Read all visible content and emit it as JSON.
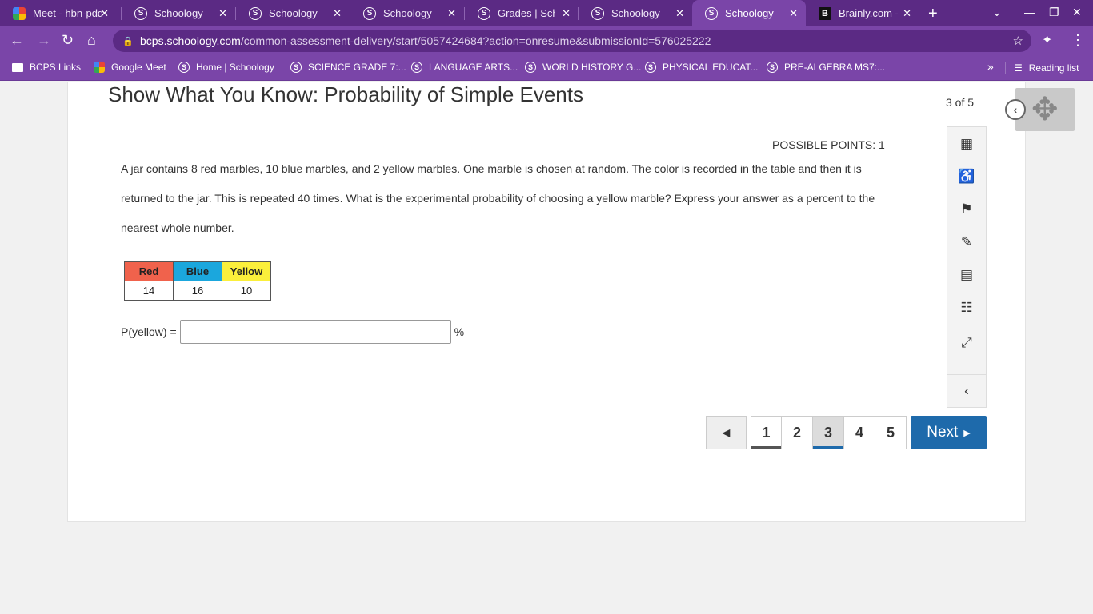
{
  "browser": {
    "tabs": [
      {
        "title": "Meet - hbn-pdq",
        "favicon": "google-meet-icon",
        "active": false
      },
      {
        "title": "Schoology",
        "favicon": "schoology-icon",
        "active": false
      },
      {
        "title": "Schoology",
        "favicon": "schoology-icon",
        "active": false
      },
      {
        "title": "Schoology",
        "favicon": "schoology-icon",
        "active": false
      },
      {
        "title": "Grades | Schoology",
        "favicon": "schoology-icon",
        "active": false
      },
      {
        "title": "Schoology",
        "favicon": "schoology-icon",
        "active": false
      },
      {
        "title": "Schoology",
        "favicon": "schoology-icon",
        "active": true
      },
      {
        "title": "Brainly.com - For",
        "favicon": "brainly-icon",
        "active": false
      }
    ],
    "url_host": "bcps.schoology.com",
    "url_path": "/common-assessment-delivery/start/5057424684?action=onresume&submissionId=576025222",
    "bookmarks": [
      {
        "label": "BCPS Links",
        "icon": "folder-icon"
      },
      {
        "label": "Google Meet",
        "icon": "google-meet-icon"
      },
      {
        "label": "Home | Schoology",
        "icon": "schoology-icon"
      },
      {
        "label": "SCIENCE GRADE 7:...",
        "icon": "schoology-icon"
      },
      {
        "label": "LANGUAGE ARTS...",
        "icon": "schoology-icon"
      },
      {
        "label": "WORLD HISTORY G...",
        "icon": "schoology-icon"
      },
      {
        "label": "PHYSICAL EDUCAT...",
        "icon": "schoology-icon"
      },
      {
        "label": "PRE-ALGEBRA MS7:...",
        "icon": "schoology-icon"
      }
    ],
    "overflow": "»",
    "reading_list": "Reading list"
  },
  "assessment": {
    "title": "Show What You Know: Probability of Simple Events",
    "counter": "3 of 5",
    "points": "POSSIBLE POINTS: 1",
    "question": "A jar contains 8 red marbles, 10 blue marbles, and 2 yellow marbles. One marble is chosen at random. The color is recorded in the table and then it is returned to the jar. This is repeated 40 times. What is the experimental probability of choosing a yellow marble? Express your answer as a percent to the nearest whole number.",
    "table": {
      "headers": [
        "Red",
        "Blue",
        "Yellow"
      ],
      "values": [
        "14",
        "16",
        "10"
      ],
      "colors": [
        "#f0624c",
        "#1ba7dd",
        "#fbef3b"
      ]
    },
    "answer_label": "P(yellow) =",
    "answer_value": "",
    "answer_unit": "%"
  },
  "pager": {
    "prev_icon": "◀",
    "pages": [
      "1",
      "2",
      "3",
      "4",
      "5"
    ],
    "current": "3",
    "next_label": "Next",
    "next_icon": "▶"
  },
  "colors": {
    "chrome_dark": "#5b2a84",
    "chrome": "#7a45a8",
    "next_button": "#1e6aab",
    "answered_underline": "#555555",
    "current_underline": "#1e6aab"
  }
}
